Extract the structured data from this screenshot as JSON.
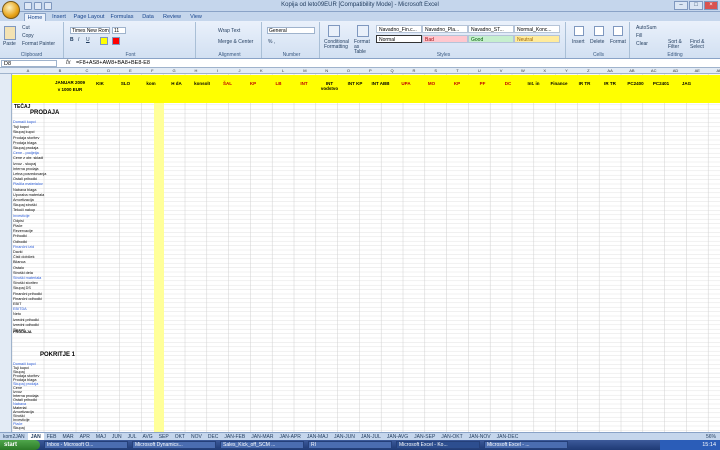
{
  "window": {
    "title": "Kopija od leto09EUR [Compatibility Mode] - Microsoft Excel"
  },
  "tabs": [
    "Home",
    "Insert",
    "Page Layout",
    "Formulas",
    "Data",
    "Review",
    "View"
  ],
  "ribbon": {
    "clipboard": {
      "paste": "Paste",
      "cut": "Cut",
      "copy": "Copy",
      "format_painter": "Format Painter",
      "label": "Clipboard"
    },
    "font": {
      "name": "Times New Rom",
      "size": "11",
      "label": "Font"
    },
    "alignment": {
      "wrap": "Wrap Text",
      "merge": "Merge & Center",
      "label": "Alignment"
    },
    "number": {
      "format": "General",
      "label": "Number"
    },
    "styles": {
      "cond_format": "Conditional Formatting",
      "format_table": "Format as Table",
      "cells": [
        "Navadno_Fin.c...",
        "Navadno_Pla...",
        "Navadno_ST...",
        "Normal_Konc...",
        "Normal",
        "Bad",
        "Good",
        "Neutral"
      ],
      "label": "Styles"
    },
    "cells_group": {
      "insert": "Insert",
      "delete": "Delete",
      "format": "Format",
      "label": "Cells"
    },
    "editing": {
      "autosum": "AutoSum",
      "fill": "Fill",
      "clear": "Clear",
      "sort": "Sort & Filter",
      "find": "Find & Select",
      "label": "Editing"
    }
  },
  "formula_bar": {
    "cell": "D8",
    "fx": "fx",
    "formula": "=F8+AS8+AW8+BA8+BE8-E8"
  },
  "sheet": {
    "header": {
      "title": "JANUAR 2009",
      "unit": "v 1000 EUR",
      "cols": [
        "KIK",
        "SLO",
        "kom",
        "H dA",
        "konsolI",
        "ŠAL",
        "KP",
        "LB",
        "INT",
        "INT vodstvo",
        "INT KP",
        "INT ABB",
        "UPA",
        "MO",
        "KP",
        "PF",
        "DC",
        "Int. in",
        "Finance",
        "IR TR",
        "IR TR",
        "PC2400",
        "PC2401",
        "JAG"
      ]
    },
    "sections": [
      "TEČAJ",
      "PRODAJA",
      "POKRITJE 1"
    ],
    "rows_top": [
      "Domači kupci",
      "Tuji kupci",
      "Skupaj kupci",
      "Prodaja storitev",
      "Prodaja blaga",
      "Skupaj prodaja",
      "Cene - podjetja",
      "Cene z obr. skladi",
      "Izvoz - skupaj",
      "Interna prodaja",
      "Letna posredovanja",
      "Ostali prihodki",
      "Plačila materialov",
      "Nabava blaga",
      "Uporaba materiala",
      "Amortizacija",
      "Skupaj stroški",
      "Tekoči nakup",
      "Investicije",
      "Odpisi",
      "Plače",
      "Rezervacije",
      "Prihodki",
      "Odhodki",
      "Finančni izid",
      "Davki",
      "Čisti dobiček",
      "Bilanca",
      "Ostalo",
      "Stroški dela",
      "Stroški materiala",
      "Stroški storitev",
      "Skupaj DS",
      "Finančni prihodki",
      "Finančni odhodki",
      "EBIT",
      "EBITDA",
      "Neto",
      "Izredni prihodki",
      "Izredni odhodki",
      "Skupaj"
    ],
    "rows_bottom": [
      "Domači kupci",
      "Tuji kupci",
      "Skupaj",
      "Prodaja storitev",
      "Prodaja blaga",
      "Skupaj prodaja",
      "Cene",
      "Izvoz",
      "Interna prodaja",
      "Ostali prihodki",
      "Nabava",
      "Material",
      "Amortizacija",
      "Stroški",
      "Investicije",
      "Plače",
      "Skupaj"
    ],
    "totals_label": "PRODAJA",
    "ok": "OK"
  },
  "sheet_tabs": [
    "kom2JAN",
    "JAN",
    "FEB",
    "MAR",
    "APR",
    "MAJ",
    "JUN",
    "JUL",
    "AVG",
    "SEP",
    "OKT",
    "NOV",
    "DEC",
    "JAN-FEB",
    "JAN-MAR",
    "JAN-APR",
    "JAN-MAJ",
    "JAN-JUN",
    "JAN-JUL",
    "JAN-AVG",
    "JAN-SEP",
    "JAN-OKT",
    "JAN-NOV",
    "JAN-DEC"
  ],
  "status": {
    "zoom": "56%"
  },
  "taskbar": {
    "start": "start",
    "tasks": [
      "Inbox - Microsoft O...",
      "Microsoft Dynamics...",
      "Sales_Kick_off_SCM ...",
      "RI",
      "Microsoft Excel - Ko...",
      "Microsoft Excel - ..."
    ],
    "time": "15:14"
  }
}
